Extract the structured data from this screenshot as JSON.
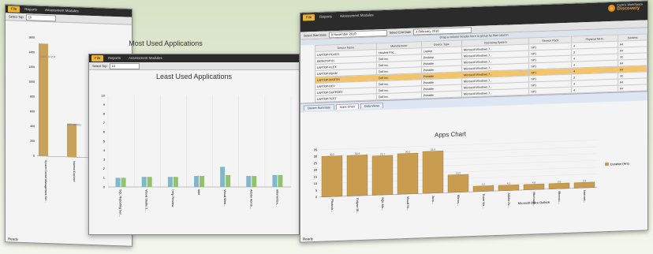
{
  "left_window": {
    "menu": [
      "File",
      "Reports",
      "Assessment Modules"
    ],
    "select_label": "Select Top",
    "select_value": "10",
    "title": "Most Used Applications",
    "status": "Ready",
    "chart_data": {
      "type": "bar",
      "title": "Most Used Applications",
      "y_ticks": [
        "1600",
        "1400",
        "1200",
        "1000",
        "800",
        "600",
        "400",
        "200",
        "0"
      ],
      "ylim": [
        0,
        1600
      ],
      "categories": [
        "System Center Management Ser...",
        "Internet Explorer"
      ],
      "values": [
        1520,
        450
      ],
      "data_labels": [
        "1,517.92254",
        "443.083811"
      ]
    }
  },
  "middle_window": {
    "menu": [
      "File",
      "Reports",
      "Assessment Modules"
    ],
    "select_label": "Select Top",
    "select_value": "10",
    "title": "Least Used Applications",
    "status": "Ready",
    "chart_data": {
      "type": "bar",
      "title": "Least Used Applications",
      "y_ticks": [
        "10",
        "9",
        "8",
        "7",
        "6",
        "5",
        "4",
        "3",
        "2",
        "1",
        "0"
      ],
      "ylim": [
        0,
        10
      ],
      "categories": [
        "SQL Reporting Ser...",
        "Visual Studio 2...",
        "Help Preview",
        "Intel",
        "Visual Web...",
        "Adobe Acrob...",
        "Internet Ex..."
      ],
      "series": [
        {
          "values": [
            1.0,
            1.1,
            1.1,
            1.2,
            2.2,
            1.2,
            1.3
          ]
        },
        {
          "values": [
            1.0,
            1.1,
            1.1,
            1.2,
            1.3,
            1.2,
            1.3
          ]
        }
      ]
    }
  },
  "right_window": {
    "menu": [
      "File",
      "Reports",
      "Assessment Modules"
    ],
    "start_label": "Select Start Date",
    "start_value": "8 November 2010",
    "end_label": "Select End Date",
    "end_value": "3 February 2010",
    "group_hint": "Drag a column header here to group by that column",
    "logo_line1": "Centrix WorkSpace",
    "logo_line2": "Discovery",
    "columns": [
      "Device Name",
      "Manufacturer",
      "Device Type",
      "Operating System",
      "Service Pack",
      "Physical Mem.",
      "Sockets"
    ],
    "rows": [
      [
        "LAPTOP-PC4321",
        "Hewlett-Pac...",
        "Laptop",
        "Microsoft Windows 7...",
        "SP1",
        "4",
        "64"
      ],
      [
        "DESKTOP-01",
        "Dell Inc.",
        "Desktop",
        "Microsoft Windows 7...",
        "SP1",
        "2",
        "64"
      ],
      [
        "LAPTOP-ALEX",
        "Dell Inc.",
        "Portable",
        "Microsoft Windows 7...",
        "SP1",
        "4",
        "32"
      ],
      [
        "LAPTOP-ADAM",
        "Dell Inc.",
        "Portable",
        "Microsoft Windows 7...",
        "SP1",
        "4",
        "64"
      ],
      [
        "LAPTOP-MARTIN",
        "Dell Inc.",
        "Portable",
        "Microsoft Windows 7...",
        "SP1",
        "4",
        "64"
      ],
      [
        "LAPTOP-DEV",
        "Dell Inc.",
        "Portable",
        "Microsoft Windows 7...",
        "SP1",
        "2",
        "32"
      ],
      [
        "LAPTOP-SUPPORT",
        "Dell Inc.",
        "Portable",
        "Microsoft Windows 7...",
        "SP1",
        "4",
        "64"
      ],
      [
        "LAPTOP-TEST",
        "Dell Inc.",
        "Portable",
        "Microsoft Windows 7...",
        "SP1",
        "4",
        "64"
      ]
    ],
    "highlighted_row": 4,
    "tabs": [
      "Device Summary",
      "Apps Chart",
      "Data Views"
    ],
    "active_tab": 1,
    "chart_title": "Apps Chart",
    "legend": "Duration (Hrs)",
    "tooltip": "Microsoft Office Outlook",
    "status": "Ready",
    "chart_data": {
      "type": "bar",
      "title": "Apps Chart",
      "y_ticks": [
        "35",
        "30",
        "25",
        "20",
        "15",
        "10",
        "5",
        "0"
      ],
      "ylim": [
        0,
        35
      ],
      "categories": [
        "Photosh...",
        "Eclipse IB...",
        "SQL Ma...",
        "Visual St...",
        "Java...",
        "Micros...",
        "Team Vie...",
        "Adobe Ac...",
        "Microsoft...",
        "Microso...",
        "Internet..."
      ],
      "values": [
        30,
        30,
        29,
        30,
        31,
        13,
        4,
        4,
        4,
        4,
        4
      ],
      "data_labels": [
        "30.5",
        "30.4",
        "29.1",
        "30.1",
        "31.6",
        "13.5",
        "4.2",
        "4.1",
        "4.0",
        "3.9",
        "3.9"
      ]
    }
  }
}
